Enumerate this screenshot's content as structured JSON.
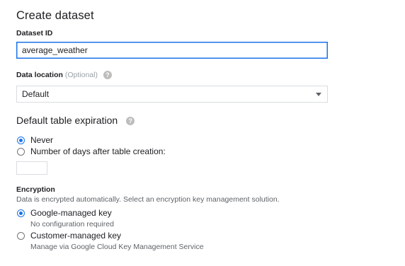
{
  "page": {
    "title": "Create dataset"
  },
  "dataset_id": {
    "label": "Dataset ID",
    "value": "average_weather"
  },
  "data_location": {
    "label": "Data location",
    "optional": "(Optional)",
    "selected": "Default",
    "help_icon": "help-circle-icon"
  },
  "table_expiration": {
    "heading": "Default table expiration",
    "help_icon": "help-circle-icon",
    "options": [
      {
        "label": "Never",
        "checked": true
      },
      {
        "label": "Number of days after table creation:",
        "checked": false
      }
    ],
    "days_value": ""
  },
  "encryption": {
    "heading": "Encryption",
    "description": "Data is encrypted automatically. Select an encryption key management solution.",
    "options": [
      {
        "label": "Google-managed key",
        "sublabel": "No configuration required",
        "checked": true
      },
      {
        "label": "Customer-managed key",
        "sublabel": "Manage via Google Cloud Key Management Service",
        "checked": false
      }
    ]
  },
  "colors": {
    "accent": "#1a73e8",
    "text": "#202124",
    "secondary_text": "#5f6368",
    "border": "#dadce0"
  }
}
